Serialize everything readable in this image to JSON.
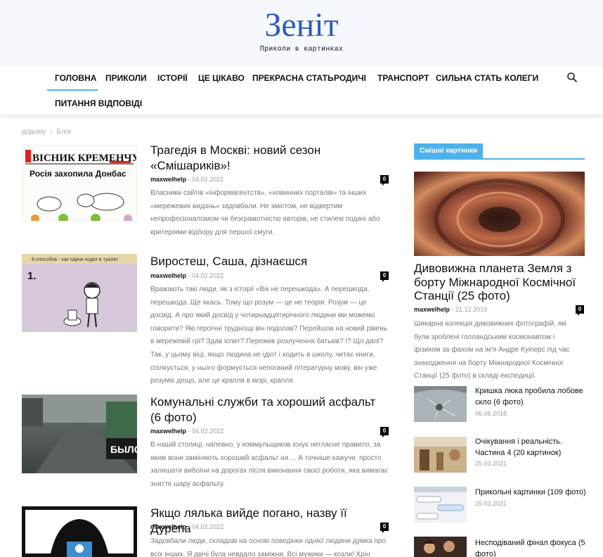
{
  "site": {
    "logo": "Зеніт",
    "tagline": "Приколи в картинках"
  },
  "nav": {
    "items": [
      "Головна",
      "Приколи",
      "Історії",
      "Це цікаво",
      "Прекрасна стать",
      "Родичі",
      "Транспорт",
      "Сильна стать",
      "Колеги",
      "Питання відповіді"
    ],
    "active": "Головна"
  },
  "breadcrumb": {
    "home": "додому",
    "separator": "›",
    "current": "Блог"
  },
  "posts": [
    {
      "title": "Трагедія в Москві: новий сезон «Смішариків»!",
      "author": "maxwelhelp",
      "date": "04.02.2022",
      "comments": "0",
      "excerpt": "Власники сайтів «інформагентств», «новинних порталів» та інших «мережевих видань» задовбали. Не змістом, не відвертим непрофесіоналізмом чи безграмотністю авторів, не стилем подачі або критеріями відбору для першої смуги.",
      "thumb_text_1": "ВІСНИК КРЕМЕНЧУКА",
      "thumb_text_2": "Росія захопила Донбас"
    },
    {
      "title": "Виростеш, Саша, дізнаєшся",
      "author": "maxwelhelp",
      "date": "04.02.2022",
      "comments": "0",
      "excerpt": "Вражають такі люди, як з історії «Вік не перешкода». А перешкода, перешкода. Ще якась. Тому що розум — це не теорія. Розум — це досвід. А про який досвід у чотирнадцятирічного людини ми можемо говорити? Які героїчні труднощі він подолав? Перейшов на новий рівень в мережевій грі? Здав іспит? Пережив розлучення батьків? І? Що далі? Так, у цьому віці, якщо людина не ідіот і ходить в школу, читає книги, спілкується, у нього формується непоганий літературну мову, він уже розуміє дещо, але це крапля в морі, крапля.",
      "thumb_text_1": "8 способов - как парни ходят в туалет",
      "thumb_text_2": "1."
    },
    {
      "title": "Комунальні служби та хороший асфальт (6 фото)",
      "author": "maxwelhelp",
      "date": "04.02.2022",
      "comments": "0",
      "excerpt": "В нашій столиці, напевно, у коммульщиков існує негласне правило, за яким вони заміняють хороший асфальт на ... А точніше кажучи, просто залишати вибоїни на дорогах після виконання своєї роботи, яка вимагає зняття шару асфальту.",
      "thumb_text_1": "БЫЛО"
    },
    {
      "title": "Якщо лялька вийде погано, назву її Дурепа",
      "author": "maxwelhelp",
      "date": "04.02.2022",
      "comments": "0",
      "excerpt": "Задовбали люди, складові на основі поведінки однієї людини думка про всіх інших. Я двічі була невдало заміжня. Всі мужики — козли! Хрін"
    }
  ],
  "sidebar": {
    "widget_title": "Смішні картинки",
    "featured": {
      "title": "Дивовижна планета Земля з борту Міжнародної Космічної Станції (25 фото)",
      "author": "maxwelhelp",
      "date": "21.12.2019",
      "comments": "0",
      "excerpt": "Шикарна колекція дивовижних фотографій, які були зроблені голландським космонавтом і фізиком за фахом на ім'я Андре Куіперс під час знаходження на борту Міжнародної Космічної Станції (25 фото) в складі експедиції."
    },
    "items": [
      {
        "title": "Кришка люка пробила лобове скло (6 фото)",
        "date": "06.06.2018"
      },
      {
        "title": "Очікування і реальність. Частина 4 (20 картинок)",
        "date": "25.03.2021"
      },
      {
        "title": "Прикольні картинки (109 фото)",
        "date": "25.03.2021"
      },
      {
        "title": "Несподіваний фінал фокуса (5 фото)",
        "date": ""
      }
    ]
  },
  "colors": {
    "accent": "#4db2ec",
    "logo": "#2e5bbd",
    "header_bg": "#f5f8fd"
  },
  "icons": {
    "search": "search-icon"
  }
}
